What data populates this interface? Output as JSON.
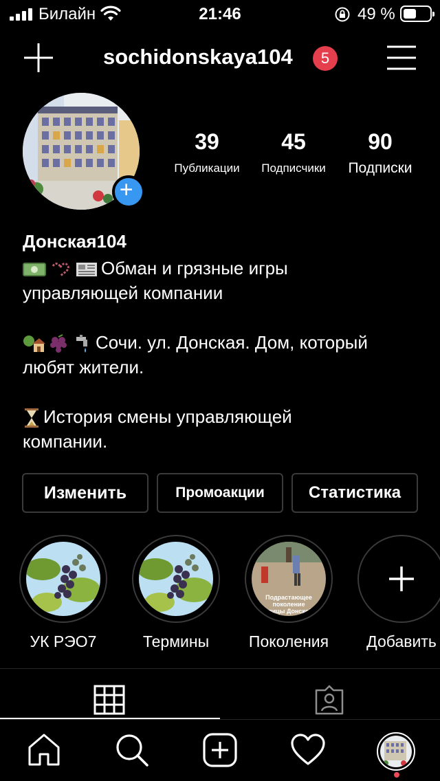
{
  "status_bar": {
    "carrier": "Билайн",
    "time": "21:46",
    "battery_percent": "49 %",
    "battery_level": 0.49
  },
  "header": {
    "username": "sochidonskaya104",
    "notification_count": "5"
  },
  "stats": [
    {
      "value": "39",
      "label": "Публикации"
    },
    {
      "value": "45",
      "label": "Подписчики"
    },
    {
      "value": "90",
      "label": "Подписки"
    }
  ],
  "bio": {
    "name": "Донская104",
    "line1": "Обман и грязные игры",
    "line2": "управляющей компании",
    "line3": "Сочи. ул. Донская. Дом, который",
    "line4": "любят жители.",
    "line5": "История смены управляющей",
    "line6": "компании."
  },
  "buttons": {
    "edit": "Изменить",
    "promo": "Промоакции",
    "stats": "Статистика"
  },
  "highlights": [
    {
      "label": "УК РЭО7"
    },
    {
      "label": "Термины"
    },
    {
      "label": "Поколения",
      "overlay": [
        "Подрастающее",
        "поколение",
        "улицы Донской"
      ]
    },
    {
      "label": "Добавить"
    }
  ],
  "colors": {
    "background": "#000000",
    "badge": "#e53e4d",
    "avatar_add": "#3897f0",
    "nav_dot": "#ed4956"
  },
  "icons": [
    "new-post-icon",
    "menu-icon",
    "grid-icon",
    "tagged-icon",
    "home-icon",
    "search-icon",
    "add-post-icon",
    "heart-icon",
    "profile-avatar-icon"
  ]
}
